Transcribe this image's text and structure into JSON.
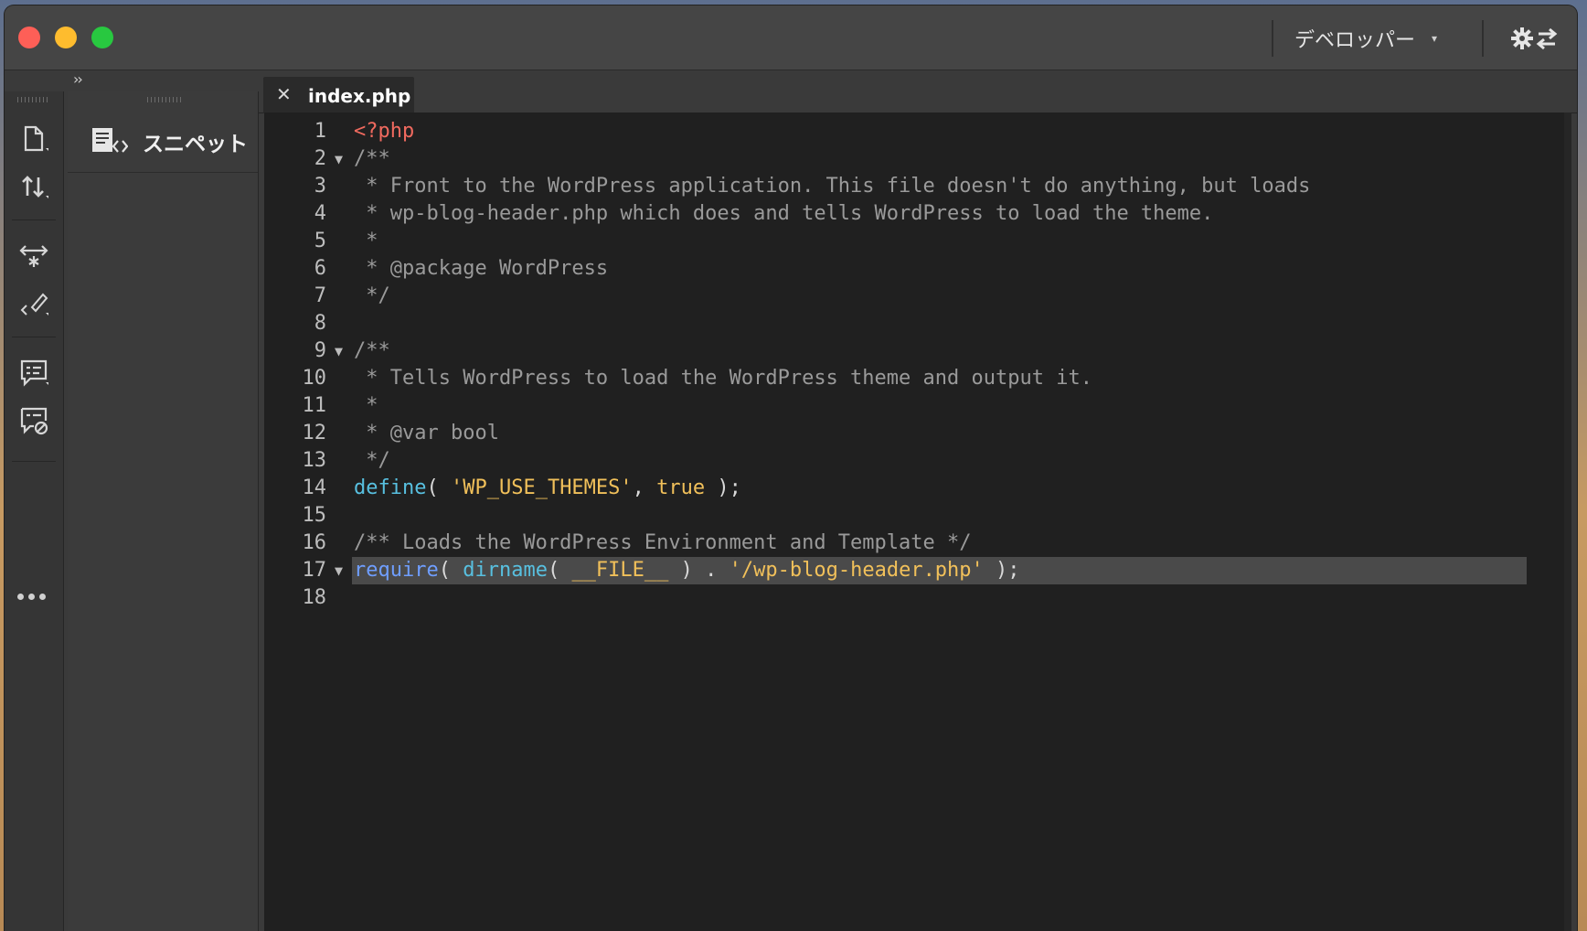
{
  "window": {
    "workspace_label": "デベロッパー",
    "workspace_caret": "▾"
  },
  "sidebar": {
    "expand_glyph": "››",
    "panel_title": "スニペット",
    "tools": [
      "new-file-icon",
      "transfer-icon",
      "expand-code-icon",
      "brush-code-icon",
      "comment-icon",
      "uncomment-icon",
      "more-icon"
    ]
  },
  "tab": {
    "close_glyph": "✕",
    "filename": "index.php"
  },
  "editor": {
    "fold_glyph": "▼",
    "lines": [
      {
        "n": "1",
        "tokens": [
          {
            "t": "<?php",
            "c": "tag"
          }
        ]
      },
      {
        "n": "2",
        "fold": true,
        "tokens": [
          {
            "t": "/**",
            "c": "comment"
          }
        ]
      },
      {
        "n": "3",
        "tokens": [
          {
            "t": " * Front to the WordPress application. This file doesn't do anything, but loads",
            "c": "comment"
          }
        ]
      },
      {
        "n": "4",
        "tokens": [
          {
            "t": " * wp-blog-header.php which does and tells WordPress to load the theme.",
            "c": "comment"
          }
        ]
      },
      {
        "n": "5",
        "tokens": [
          {
            "t": " *",
            "c": "comment"
          }
        ]
      },
      {
        "n": "6",
        "tokens": [
          {
            "t": " * @package WordPress",
            "c": "comment"
          }
        ]
      },
      {
        "n": "7",
        "tokens": [
          {
            "t": " */",
            "c": "comment"
          }
        ]
      },
      {
        "n": "8",
        "tokens": []
      },
      {
        "n": "9",
        "fold": true,
        "tokens": [
          {
            "t": "/**",
            "c": "comment"
          }
        ]
      },
      {
        "n": "10",
        "tokens": [
          {
            "t": " * Tells WordPress to load the WordPress theme and output it.",
            "c": "comment"
          }
        ]
      },
      {
        "n": "11",
        "tokens": [
          {
            "t": " *",
            "c": "comment"
          }
        ]
      },
      {
        "n": "12",
        "tokens": [
          {
            "t": " * @var bool",
            "c": "comment"
          }
        ]
      },
      {
        "n": "13",
        "tokens": [
          {
            "t": " */",
            "c": "comment"
          }
        ]
      },
      {
        "n": "14",
        "tokens": [
          {
            "t": "define",
            "c": "func"
          },
          {
            "t": "( ",
            "c": "plain"
          },
          {
            "t": "'WP_USE_THEMES'",
            "c": "str"
          },
          {
            "t": ", ",
            "c": "plain"
          },
          {
            "t": "true",
            "c": "bool"
          },
          {
            "t": " );",
            "c": "plain"
          }
        ]
      },
      {
        "n": "15",
        "tokens": []
      },
      {
        "n": "16",
        "tokens": [
          {
            "t": "/** Loads the WordPress Environment and Template */",
            "c": "comment"
          }
        ]
      },
      {
        "n": "17",
        "fold": true,
        "highlight": true,
        "tokens": [
          {
            "t": "require",
            "c": "kw"
          },
          {
            "t": "( ",
            "c": "plain"
          },
          {
            "t": "dirname",
            "c": "func"
          },
          {
            "t": "( ",
            "c": "plain"
          },
          {
            "t": "__FILE__",
            "c": "const"
          },
          {
            "t": " ) . ",
            "c": "plain"
          },
          {
            "t": "'/wp-blog-header.php'",
            "c": "str"
          },
          {
            "t": " );",
            "c": "plain"
          }
        ]
      },
      {
        "n": "18",
        "tokens": []
      }
    ]
  }
}
